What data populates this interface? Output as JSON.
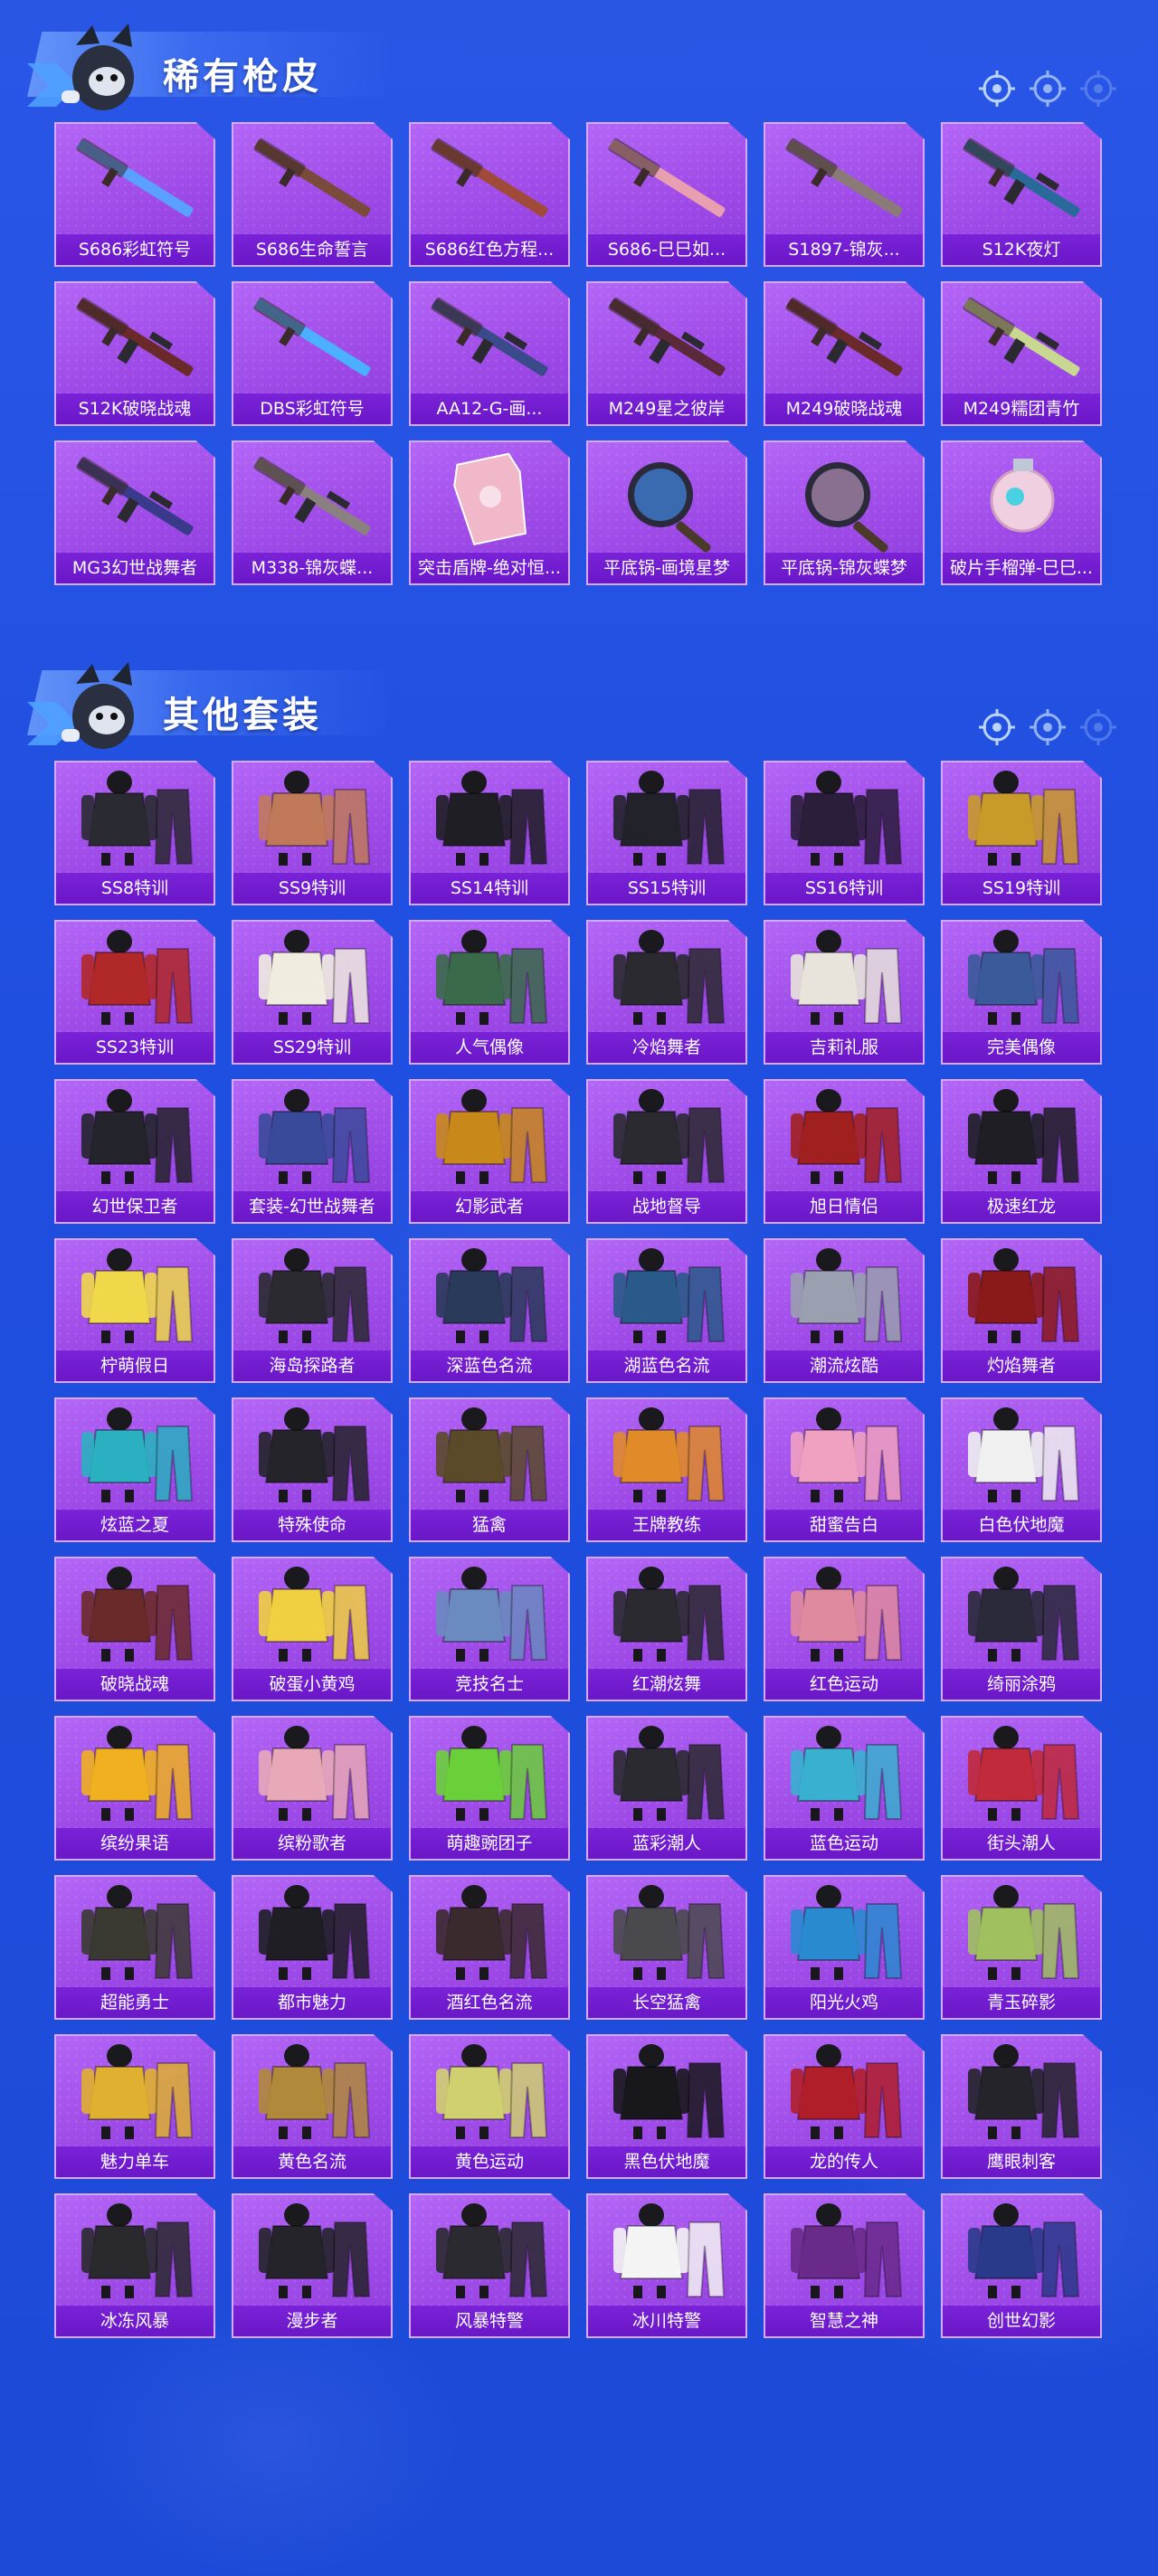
{
  "sections": [
    {
      "title": "稀有枪皮",
      "kind": "weapon",
      "items": [
        {
          "label": "S686彩虹符号",
          "icon": "shotgun-icon",
          "color": "#5aa0ff"
        },
        {
          "label": "S686生命誓言",
          "icon": "shotgun-icon",
          "color": "#7a4a3a"
        },
        {
          "label": "S686红色方程...",
          "icon": "shotgun-icon",
          "color": "#a04a3a"
        },
        {
          "label": "S686-巳巳如...",
          "icon": "shotgun-icon",
          "color": "#e8a0b0"
        },
        {
          "label": "S1897-锦灰...",
          "icon": "shotgun-icon",
          "color": "#8a7a78"
        },
        {
          "label": "S12K夜灯",
          "icon": "rifle-icon",
          "color": "#2a6a9a"
        },
        {
          "label": "S12K破晓战魂",
          "icon": "rifle-icon",
          "color": "#6a2a2a"
        },
        {
          "label": "DBS彩虹符号",
          "icon": "shotgun-icon",
          "color": "#4ab0ff"
        },
        {
          "label": "AA12-G-画...",
          "icon": "rifle-icon",
          "color": "#3a4a8a"
        },
        {
          "label": "M249星之彼岸",
          "icon": "machine-gun-icon",
          "color": "#5a2a3a"
        },
        {
          "label": "M249破晓战魂",
          "icon": "machine-gun-icon",
          "color": "#6a2a2a"
        },
        {
          "label": "M249糯团青竹",
          "icon": "machine-gun-icon",
          "color": "#c8d890"
        },
        {
          "label": "MG3幻世战舞者",
          "icon": "machine-gun-icon",
          "color": "#3a3a8a"
        },
        {
          "label": "M338-锦灰蝶...",
          "icon": "rifle-icon",
          "color": "#8a8080"
        },
        {
          "label": "突击盾牌-绝对恒...",
          "icon": "shield-icon",
          "color": "#f0b8c8"
        },
        {
          "label": "平底锅-画境星梦",
          "icon": "pan-icon",
          "color": "#3a6ab0"
        },
        {
          "label": "平底锅-锦灰蝶梦",
          "icon": "pan-icon",
          "color": "#8a7090"
        },
        {
          "label": "破片手榴弹-巳巳...",
          "icon": "grenade-icon",
          "color": "#f0d0e0"
        }
      ]
    },
    {
      "title": "其他套装",
      "kind": "outfit",
      "items": [
        {
          "label": "SS8特训",
          "icon": "outfit-icon",
          "color": "#2a2a32"
        },
        {
          "label": "SS9特训",
          "icon": "outfit-icon",
          "color": "#c07a5a"
        },
        {
          "label": "SS14特训",
          "icon": "outfit-icon",
          "color": "#1e1e24"
        },
        {
          "label": "SS15特训",
          "icon": "outfit-icon",
          "color": "#22222a"
        },
        {
          "label": "SS16特训",
          "icon": "outfit-icon",
          "color": "#2a1e3a"
        },
        {
          "label": "SS19特训",
          "icon": "outfit-icon",
          "color": "#c89a2a"
        },
        {
          "label": "SS23特训",
          "icon": "outfit-icon",
          "color": "#b02828"
        },
        {
          "label": "SS29特训",
          "icon": "outfit-icon",
          "color": "#f0ece0"
        },
        {
          "label": "人气偶像",
          "icon": "outfit-icon",
          "color": "#3a6a4a"
        },
        {
          "label": "冷焰舞者",
          "icon": "outfit-icon",
          "color": "#2a2a30"
        },
        {
          "label": "吉莉礼服",
          "icon": "outfit-icon",
          "color": "#e8e4dc"
        },
        {
          "label": "完美偶像",
          "icon": "outfit-icon",
          "color": "#3a5a9a"
        },
        {
          "label": "幻世保卫者",
          "icon": "outfit-icon",
          "color": "#24242c"
        },
        {
          "label": "套装-幻世战舞者",
          "icon": "outfit-icon",
          "color": "#3a4a9a"
        },
        {
          "label": "幻影武者",
          "icon": "outfit-icon",
          "color": "#c8881a"
        },
        {
          "label": "战地督导",
          "icon": "outfit-icon",
          "color": "#2a2a30"
        },
        {
          "label": "旭日情侣",
          "icon": "outfit-icon",
          "color": "#a02020"
        },
        {
          "label": "极速红龙",
          "icon": "outfit-icon",
          "color": "#1e1e24"
        },
        {
          "label": "柠萌假日",
          "icon": "outfit-icon",
          "color": "#f0d84a"
        },
        {
          "label": "海岛探路者",
          "icon": "outfit-icon",
          "color": "#2a2a30"
        },
        {
          "label": "深蓝色名流",
          "icon": "outfit-icon",
          "color": "#2a3a5a"
        },
        {
          "label": "湖蓝色名流",
          "icon": "outfit-icon",
          "color": "#2a5a8a"
        },
        {
          "label": "潮流炫酷",
          "icon": "outfit-icon",
          "color": "#9aa0b0"
        },
        {
          "label": "灼焰舞者",
          "icon": "outfit-icon",
          "color": "#8a1a1a"
        },
        {
          "label": "炫蓝之夏",
          "icon": "outfit-icon",
          "color": "#2ab0c0"
        },
        {
          "label": "特殊使命",
          "icon": "outfit-icon",
          "color": "#24242a"
        },
        {
          "label": "猛禽",
          "icon": "outfit-icon",
          "color": "#5a4a2a"
        },
        {
          "label": "王牌教练",
          "icon": "outfit-icon",
          "color": "#e08a2a"
        },
        {
          "label": "甜蜜告白",
          "icon": "outfit-icon",
          "color": "#f0a0c0"
        },
        {
          "label": "白色伏地魔",
          "icon": "outfit-icon",
          "color": "#f0f0f0"
        },
        {
          "label": "破晓战魂",
          "icon": "outfit-icon",
          "color": "#6a2a2a"
        },
        {
          "label": "破蛋小黄鸡",
          "icon": "outfit-icon",
          "color": "#f0d040"
        },
        {
          "label": "竞技名士",
          "icon": "outfit-icon",
          "color": "#6a8ac0"
        },
        {
          "label": "红潮炫舞",
          "icon": "outfit-icon",
          "color": "#2a2a30"
        },
        {
          "label": "红色运动",
          "icon": "outfit-icon",
          "color": "#e08aa0"
        },
        {
          "label": "绮丽涂鸦",
          "icon": "outfit-icon",
          "color": "#2a2a3a"
        },
        {
          "label": "缤纷果语",
          "icon": "outfit-icon",
          "color": "#f0b020"
        },
        {
          "label": "缤粉歌者",
          "icon": "outfit-icon",
          "color": "#e8a8b8"
        },
        {
          "label": "萌趣豌团子",
          "icon": "outfit-icon",
          "color": "#6ad03a"
        },
        {
          "label": "蓝彩潮人",
          "icon": "outfit-icon",
          "color": "#2a2a30"
        },
        {
          "label": "蓝色运动",
          "icon": "outfit-icon",
          "color": "#3ab0d0"
        },
        {
          "label": "街头潮人",
          "icon": "outfit-icon",
          "color": "#c02a3a"
        },
        {
          "label": "超能勇士",
          "icon": "outfit-icon",
          "color": "#3a3a32"
        },
        {
          "label": "都市魅力",
          "icon": "outfit-icon",
          "color": "#1e1e24"
        },
        {
          "label": "酒红色名流",
          "icon": "outfit-icon",
          "color": "#3a2a2e"
        },
        {
          "label": "长空猛禽",
          "icon": "outfit-icon",
          "color": "#4a4a4e"
        },
        {
          "label": "阳光火鸡",
          "icon": "outfit-icon",
          "color": "#2a8ad0"
        },
        {
          "label": "青玉碎影",
          "icon": "outfit-icon",
          "color": "#a0c060"
        },
        {
          "label": "魅力单车",
          "icon": "outfit-icon",
          "color": "#e0b030"
        },
        {
          "label": "黄色名流",
          "icon": "outfit-icon",
          "color": "#b08a3a"
        },
        {
          "label": "黄色运动",
          "icon": "outfit-icon",
          "color": "#d0d070"
        },
        {
          "label": "黑色伏地魔",
          "icon": "outfit-icon",
          "color": "#18181c"
        },
        {
          "label": "龙的传人",
          "icon": "outfit-icon",
          "color": "#b01e2a"
        },
        {
          "label": "鹰眼刺客",
          "icon": "outfit-icon",
          "color": "#24242a"
        },
        {
          "label": "冰冻风暴",
          "icon": "outfit-icon",
          "color": "#2a2a2e"
        },
        {
          "label": "漫步者",
          "icon": "outfit-icon",
          "color": "#24242a"
        },
        {
          "label": "风暴特警",
          "icon": "outfit-icon",
          "color": "#2a2a30"
        },
        {
          "label": "冰川特警",
          "icon": "outfit-icon",
          "color": "#f4f4f4"
        },
        {
          "label": "智慧之神",
          "icon": "outfit-icon",
          "color": "#6a2a8a"
        },
        {
          "label": "创世幻影",
          "icon": "outfit-icon",
          "color": "#2a3a8a"
        }
      ]
    }
  ],
  "colors": {
    "card_bg": "#a452ec",
    "label_bg": "#7a22d8",
    "page_bg": "#2150e0"
  }
}
